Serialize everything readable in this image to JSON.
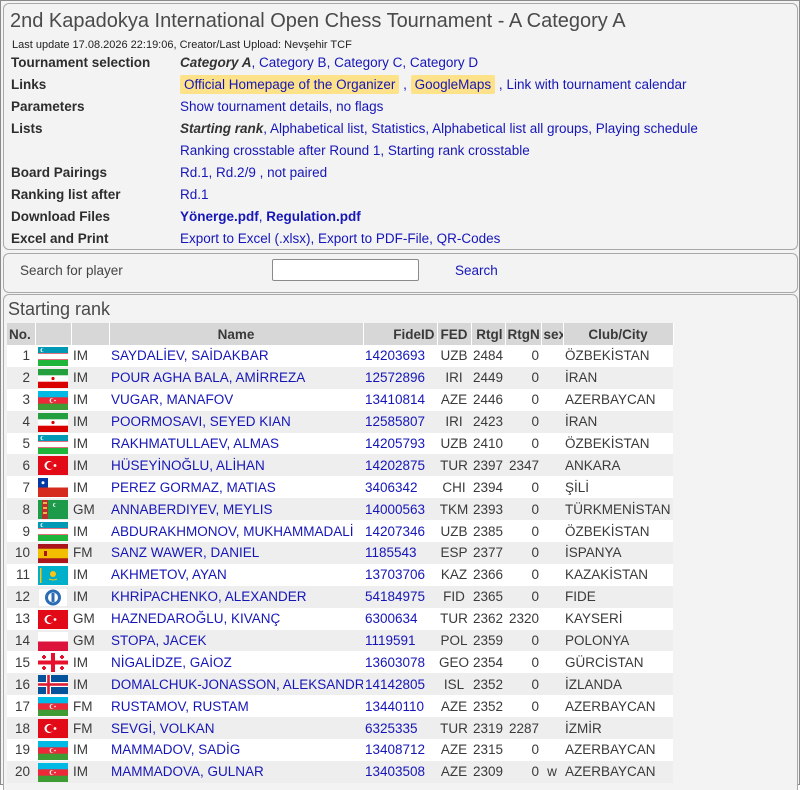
{
  "title": "2nd Kapadokya International Open Chess Tournament - A Category A",
  "last_update": "Last update 17.08.2026 22:19:06, Creator/Last Upload: Nevşehir TCF",
  "info_rows": {
    "tournament_selection": {
      "label": "Tournament selection",
      "current": "Category A",
      "others": [
        "Category B",
        "Category C",
        "Category D"
      ]
    },
    "links": {
      "label": "Links",
      "items": [
        "Official Homepage of the Organizer",
        "GoogleMaps",
        "Link with tournament calendar"
      ]
    },
    "parameters": {
      "label": "Parameters",
      "items": [
        "Show tournament details",
        "no flags"
      ]
    },
    "lists": {
      "label": "Lists",
      "current": "Starting rank",
      "items": [
        "Alphabetical list",
        "Statistics",
        "Alphabetical list all groups",
        "Playing schedule"
      ],
      "items2": [
        "Ranking crosstable after Round 1",
        "Starting rank crosstable"
      ]
    },
    "board_pairings": {
      "label": "Board Pairings",
      "items": [
        "Rd.1",
        "Rd.2/9 , not paired"
      ]
    },
    "ranking_list": {
      "label": "Ranking list after",
      "items": [
        "Rd.1"
      ]
    },
    "download": {
      "label": "Download Files",
      "items": [
        "Yönerge.pdf",
        "Regulation.pdf"
      ]
    },
    "excel": {
      "label": "Excel and Print",
      "items": [
        "Export to Excel (.xlsx)",
        "Export to PDF-File",
        "QR-Codes"
      ]
    }
  },
  "search": {
    "label": "Search for player",
    "button": "Search"
  },
  "starting_rank": {
    "title": "Starting rank",
    "headers": [
      "No.",
      "",
      "",
      "Name",
      "FideID",
      "FED",
      "Rtgl",
      "RtgN",
      "sex",
      "Club/City"
    ],
    "rows": [
      {
        "no": "1",
        "fed_flag": "UZB",
        "title": "IM",
        "name": "SAYDALİEV, SAİDAKBAR",
        "fide": "14203693",
        "fed": "UZB",
        "rtgi": "2484",
        "rtgn": "0",
        "sex": "",
        "club": "ÖZBEKİSTAN"
      },
      {
        "no": "2",
        "fed_flag": "IRI",
        "title": "IM",
        "name": "POUR AGHA BALA, AMİRREZA",
        "fide": "12572896",
        "fed": "IRI",
        "rtgi": "2449",
        "rtgn": "0",
        "sex": "",
        "club": "İRAN"
      },
      {
        "no": "3",
        "fed_flag": "AZE",
        "title": "IM",
        "name": "VUGAR, MANAFOV",
        "fide": "13410814",
        "fed": "AZE",
        "rtgi": "2446",
        "rtgn": "0",
        "sex": "",
        "club": "AZERBAYCAN"
      },
      {
        "no": "4",
        "fed_flag": "IRI",
        "title": "IM",
        "name": "POORMOSAVI, SEYED KIAN",
        "fide": "12585807",
        "fed": "IRI",
        "rtgi": "2423",
        "rtgn": "0",
        "sex": "",
        "club": "İRAN"
      },
      {
        "no": "5",
        "fed_flag": "UZB",
        "title": "IM",
        "name": "RAKHMATULLAEV, ALMAS",
        "fide": "14205793",
        "fed": "UZB",
        "rtgi": "2410",
        "rtgn": "0",
        "sex": "",
        "club": "ÖZBEKİSTAN"
      },
      {
        "no": "6",
        "fed_flag": "TUR",
        "title": "IM",
        "name": "HÜSEYİNOĞLU, ALİHAN",
        "fide": "14202875",
        "fed": "TUR",
        "rtgi": "2397",
        "rtgn": "2347",
        "sex": "",
        "club": "ANKARA"
      },
      {
        "no": "7",
        "fed_flag": "CHI",
        "title": "IM",
        "name": "PEREZ GORMAZ, MATIAS",
        "fide": "3406342",
        "fed": "CHI",
        "rtgi": "2394",
        "rtgn": "0",
        "sex": "",
        "club": "ŞİLİ"
      },
      {
        "no": "8",
        "fed_flag": "TKM",
        "title": "GM",
        "name": "ANNABERDIYEV, MEYLIS",
        "fide": "14000563",
        "fed": "TKM",
        "rtgi": "2393",
        "rtgn": "0",
        "sex": "",
        "club": "TÜRKMENİSTAN"
      },
      {
        "no": "9",
        "fed_flag": "UZB",
        "title": "IM",
        "name": "ABDURAKHMONOV, MUKHAMMADALİ",
        "fide": "14207346",
        "fed": "UZB",
        "rtgi": "2385",
        "rtgn": "0",
        "sex": "",
        "club": "ÖZBEKİSTAN"
      },
      {
        "no": "10",
        "fed_flag": "ESP",
        "title": "FM",
        "name": "SANZ WAWER, DANIEL",
        "fide": "1185543",
        "fed": "ESP",
        "rtgi": "2377",
        "rtgn": "0",
        "sex": "",
        "club": "İSPANYA"
      },
      {
        "no": "11",
        "fed_flag": "KAZ",
        "title": "IM",
        "name": "AKHMETOV, AYAN",
        "fide": "13703706",
        "fed": "KAZ",
        "rtgi": "2366",
        "rtgn": "0",
        "sex": "",
        "club": "KAZAKİSTAN"
      },
      {
        "no": "12",
        "fed_flag": "FID",
        "title": "IM",
        "name": "KHRİPACHENKO, ALEXANDER",
        "fide": "54184975",
        "fed": "FID",
        "rtgi": "2365",
        "rtgn": "0",
        "sex": "",
        "club": "FIDE"
      },
      {
        "no": "13",
        "fed_flag": "TUR",
        "title": "GM",
        "name": "HAZNEDAROĞLU, KIVANÇ",
        "fide": "6300634",
        "fed": "TUR",
        "rtgi": "2362",
        "rtgn": "2320",
        "sex": "",
        "club": "KAYSERİ"
      },
      {
        "no": "14",
        "fed_flag": "POL",
        "title": "GM",
        "name": "STOPA, JACEK",
        "fide": "1119591",
        "fed": "POL",
        "rtgi": "2359",
        "rtgn": "0",
        "sex": "",
        "club": "POLONYA"
      },
      {
        "no": "15",
        "fed_flag": "GEO",
        "title": "IM",
        "name": "NİGALİDZE, GAİOZ",
        "fide": "13603078",
        "fed": "GEO",
        "rtgi": "2354",
        "rtgn": "0",
        "sex": "",
        "club": "GÜRCİSTAN"
      },
      {
        "no": "16",
        "fed_flag": "ISL",
        "title": "IM",
        "name": "DOMALCHUK-JONASSON, ALEKSANDR",
        "fide": "14142805",
        "fed": "ISL",
        "rtgi": "2352",
        "rtgn": "0",
        "sex": "",
        "club": "İZLANDA"
      },
      {
        "no": "17",
        "fed_flag": "AZE",
        "title": "FM",
        "name": "RUSTAMOV, RUSTAM",
        "fide": "13440110",
        "fed": "AZE",
        "rtgi": "2352",
        "rtgn": "0",
        "sex": "",
        "club": "AZERBAYCAN"
      },
      {
        "no": "18",
        "fed_flag": "TUR",
        "title": "FM",
        "name": "SEVGİ, VOLKAN",
        "fide": "6325335",
        "fed": "TUR",
        "rtgi": "2319",
        "rtgn": "2287",
        "sex": "",
        "club": "İZMİR"
      },
      {
        "no": "19",
        "fed_flag": "AZE",
        "title": "IM",
        "name": "MAMMADOV, SADİG",
        "fide": "13408712",
        "fed": "AZE",
        "rtgi": "2315",
        "rtgn": "0",
        "sex": "",
        "club": "AZERBAYCAN"
      },
      {
        "no": "20",
        "fed_flag": "AZE",
        "title": "IM",
        "name": "MAMMADOVA, GULNAR",
        "fide": "13403508",
        "fed": "AZE",
        "rtgi": "2309",
        "rtgn": "0",
        "sex": "w",
        "club": "AZERBAYCAN"
      }
    ]
  }
}
